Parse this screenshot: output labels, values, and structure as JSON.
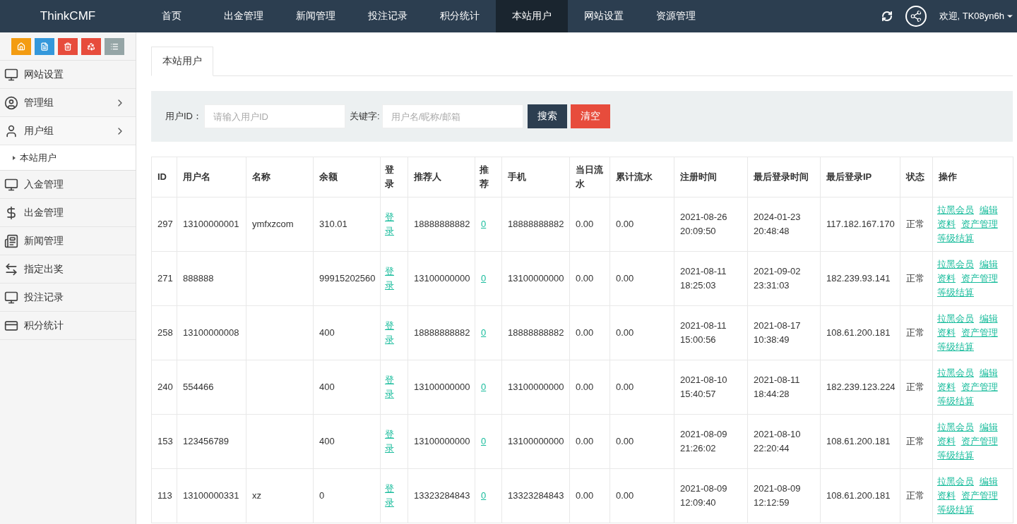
{
  "topbar": {
    "brand": "ThinkCMF",
    "nav": [
      {
        "label": "首页",
        "selected": false
      },
      {
        "label": "出金管理",
        "selected": false
      },
      {
        "label": "新闻管理",
        "selected": false
      },
      {
        "label": "投注记录",
        "selected": false
      },
      {
        "label": "积分统计",
        "selected": false
      },
      {
        "label": "本站用户",
        "selected": true
      },
      {
        "label": "网站设置",
        "selected": false
      },
      {
        "label": "资源管理",
        "selected": false
      }
    ],
    "welcome": "欢迎, TK08yn6h"
  },
  "sidebar": {
    "items": [
      {
        "label": "网站设置",
        "has_arrow": false,
        "expanded": false
      },
      {
        "label": "管理组",
        "has_arrow": true,
        "expanded": false
      },
      {
        "label": "用户组",
        "has_arrow": true,
        "expanded": true,
        "children": [
          {
            "label": "本站用户"
          }
        ]
      },
      {
        "label": "入金管理",
        "has_arrow": false,
        "expanded": false
      },
      {
        "label": "出金管理",
        "has_arrow": false,
        "expanded": false
      },
      {
        "label": "新闻管理",
        "has_arrow": false,
        "expanded": false
      },
      {
        "label": "指定出奖",
        "has_arrow": false,
        "expanded": false
      },
      {
        "label": "投注记录",
        "has_arrow": false,
        "expanded": false
      },
      {
        "label": "积分统计",
        "has_arrow": false,
        "expanded": false
      }
    ]
  },
  "tabs": [
    {
      "label": "本站用户",
      "selected": true
    }
  ],
  "search": {
    "user_id_label": "用户ID：",
    "user_id_placeholder": "请输入用户ID",
    "keyword_label": "关键字:",
    "keyword_placeholder": "用户名/昵称/邮箱",
    "search_button": "搜索",
    "clear_button": "清空"
  },
  "table": {
    "columns": [
      "ID",
      "用户名",
      "名称",
      "余额",
      "登录",
      "推荐人",
      "推荐",
      "手机",
      "当日流水",
      "累计流水",
      "注册时间",
      "最后登录时间",
      "最后登录IP",
      "状态",
      "操作"
    ],
    "rows": [
      {
        "id": "297",
        "username": "13100000001",
        "name": "ymfxzcom",
        "balance": "310.01",
        "login": "登录",
        "referrer": "18888888882",
        "referrals": "0",
        "phone": "18888888882",
        "daily_flow": "0.00",
        "total_flow": "0.00",
        "registered": "2021-08-26 20:09:50",
        "last_login": "2024-01-23 20:48:48",
        "last_ip": "117.182.167.170",
        "status": "正常",
        "actions": [
          "拉黑会员",
          "编辑",
          "资料",
          "资产管理",
          "等级结算"
        ]
      },
      {
        "id": "271",
        "username": "888888",
        "name": "",
        "balance": "99915202560",
        "login": "登录",
        "referrer": "13100000000",
        "referrals": "0",
        "phone": "13100000000",
        "daily_flow": "0.00",
        "total_flow": "0.00",
        "registered": "2021-08-11 18:25:03",
        "last_login": "2021-09-02 23:31:03",
        "last_ip": "182.239.93.141",
        "status": "正常",
        "actions": [
          "拉黑会员",
          "编辑",
          "资料",
          "资产管理",
          "等级结算"
        ]
      },
      {
        "id": "258",
        "username": "13100000008",
        "name": "",
        "balance": "400",
        "login": "登录",
        "referrer": "18888888882",
        "referrals": "0",
        "phone": "18888888882",
        "daily_flow": "0.00",
        "total_flow": "0.00",
        "registered": "2021-08-11 15:00:56",
        "last_login": "2021-08-17 10:38:49",
        "last_ip": "108.61.200.181",
        "status": "正常",
        "actions": [
          "拉黑会员",
          "编辑",
          "资料",
          "资产管理",
          "等级结算"
        ]
      },
      {
        "id": "240",
        "username": "554466",
        "name": "",
        "balance": "400",
        "login": "登录",
        "referrer": "13100000000",
        "referrals": "0",
        "phone": "13100000000",
        "daily_flow": "0.00",
        "total_flow": "0.00",
        "registered": "2021-08-10 15:40:57",
        "last_login": "2021-08-11 18:44:28",
        "last_ip": "182.239.123.224",
        "status": "正常",
        "actions": [
          "拉黑会员",
          "编辑",
          "资料",
          "资产管理",
          "等级结算"
        ]
      },
      {
        "id": "153",
        "username": "123456789",
        "name": "",
        "balance": "400",
        "login": "登录",
        "referrer": "13100000000",
        "referrals": "0",
        "phone": "13100000000",
        "daily_flow": "0.00",
        "total_flow": "0.00",
        "registered": "2021-08-09 21:26:02",
        "last_login": "2021-08-10 22:20:44",
        "last_ip": "108.61.200.181",
        "status": "正常",
        "actions": [
          "拉黑会员",
          "编辑",
          "资料",
          "资产管理",
          "等级结算"
        ]
      },
      {
        "id": "113",
        "username": "13100000331",
        "name": "xz",
        "balance": "0",
        "login": "登录",
        "referrer": "13323284843",
        "referrals": "0",
        "phone": "13323284843",
        "daily_flow": "0.00",
        "total_flow": "0.00",
        "registered": "2021-08-09 12:09:40",
        "last_login": "2021-08-09 12:12:59",
        "last_ip": "108.61.200.181",
        "status": "正常",
        "actions": [
          "拉黑会员",
          "编辑",
          "资料",
          "资产管理",
          "等级结算"
        ]
      }
    ]
  }
}
